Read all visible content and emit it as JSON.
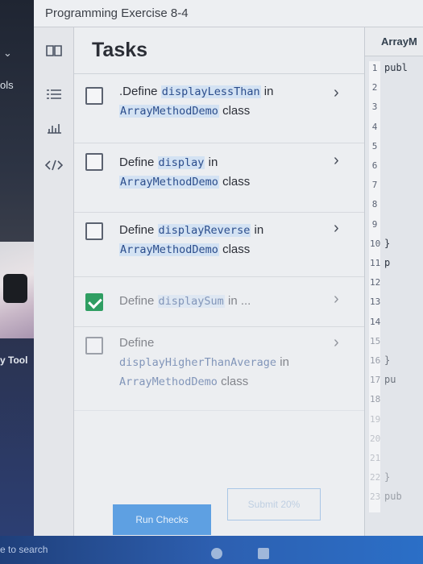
{
  "window": {
    "title": "Programming Exercise 8-4"
  },
  "desktop": {
    "left_label_1": "ols",
    "left_label_2": "y Tool",
    "search_hint": "e to search"
  },
  "panel": {
    "title": "Tasks"
  },
  "tasks": [
    {
      "prefix": ".Define ",
      "code": "displayLessThan",
      "mid": " in",
      "class_code": "ArrayMethodDemo",
      "suffix": " class",
      "checked": false
    },
    {
      "prefix": "Define ",
      "code": "display",
      "mid": " in",
      "class_code": "ArrayMethodDemo",
      "suffix": " class",
      "checked": false
    },
    {
      "prefix": "Define ",
      "code": "displayReverse",
      "mid": " in",
      "class_code": "ArrayMethodDemo",
      "suffix": " class",
      "checked": false
    },
    {
      "prefix": "Define ",
      "code": "displaySum",
      "mid": " in ...",
      "checked": true
    },
    {
      "prefix": "Define",
      "code": "displayHigherThanAverage",
      "mid": " in",
      "class_code": "ArrayMethodDemo",
      "suffix": " class",
      "checked": false
    }
  ],
  "buttons": {
    "run_checks": "Run Checks",
    "submit": "Submit 20%"
  },
  "editor": {
    "tab_label": "ArrayM",
    "line_numbers": [
      "1",
      "2",
      "3",
      "4",
      "5",
      "6",
      "7",
      "8",
      "9",
      "10",
      "11",
      "12",
      "13",
      "14",
      "15",
      "16",
      "17",
      "18",
      "19",
      "20",
      "21",
      "22",
      "23"
    ],
    "code_lines": [
      {
        "line": "1",
        "text": "publ"
      },
      {
        "line": "10",
        "text": "  }"
      },
      {
        "line": "11",
        "text": "   p"
      },
      {
        "line": "16",
        "text": "  }"
      },
      {
        "line": "17",
        "text": "   pu"
      },
      {
        "line": "22",
        "text": "  }"
      },
      {
        "line": "23",
        "text": "   pub"
      }
    ]
  },
  "icons": {
    "rail": [
      "book-icon",
      "list-icon",
      "chart-icon",
      "code-icon"
    ],
    "chevron": "chevron-right-icon"
  }
}
